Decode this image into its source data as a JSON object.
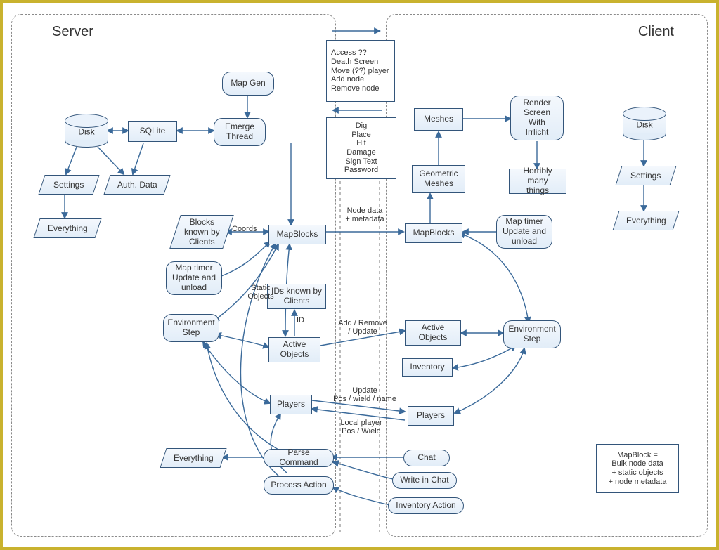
{
  "title_server": "Server",
  "title_client": "Client",
  "top_msg_box": "Access ??\nDeath Screen\nMove (??) player\nAdd node\nRemove node",
  "bottom_msg_box": "Dig\nPlace\nHit\nDamage\nSign Text\nPassword",
  "server": {
    "disk": "Disk",
    "sqlite": "SQLite",
    "mapgen": "Map Gen",
    "emerge": "Emerge\nThread",
    "settings": "Settings",
    "auth": "Auth. Data",
    "everything1": "Everything",
    "blocks_known": "Blocks\nknown by\nClients",
    "map_timer": "Map timer\nUpdate and\nunload",
    "mapblocks": "MapBlocks",
    "env_step": "Environment\nStep",
    "ids_known": "IDs known by\nClients",
    "active_objects": "Active\nObjects",
    "players": "Players",
    "parse_cmd": "Parse Command",
    "process_action": "Process Action",
    "everything2": "Everything"
  },
  "client": {
    "meshes": "Meshes",
    "render": "Render\nScreen\nWith\nIrrlicht",
    "horribly": "Horribly many\nthings",
    "geom": "Geometric\nMeshes",
    "mapblocks": "MapBlocks",
    "map_timer": "Map timer\nUpdate and\nunload",
    "active_objects": "Active\nObjects",
    "env_step": "Environment\nStep",
    "inventory": "Inventory",
    "players": "Players",
    "chat": "Chat",
    "write_chat": "Write in Chat",
    "inventory_action": "Inventory Action",
    "disk": "Disk",
    "settings": "Settings",
    "everything": "Everything"
  },
  "edge_labels": {
    "coords": "Coords",
    "node_data": "Node data\n+ metadata",
    "static_objects": "Static\nObjects",
    "id": "ID",
    "add_remove": "Add / Remove\n/ Update",
    "update_pos": "Update\nPos / wield / name",
    "local_player": "Local player\nPos / Wield"
  },
  "legend": "MapBlock =\nBulk node data\n+ static objects\n+ node metadata"
}
